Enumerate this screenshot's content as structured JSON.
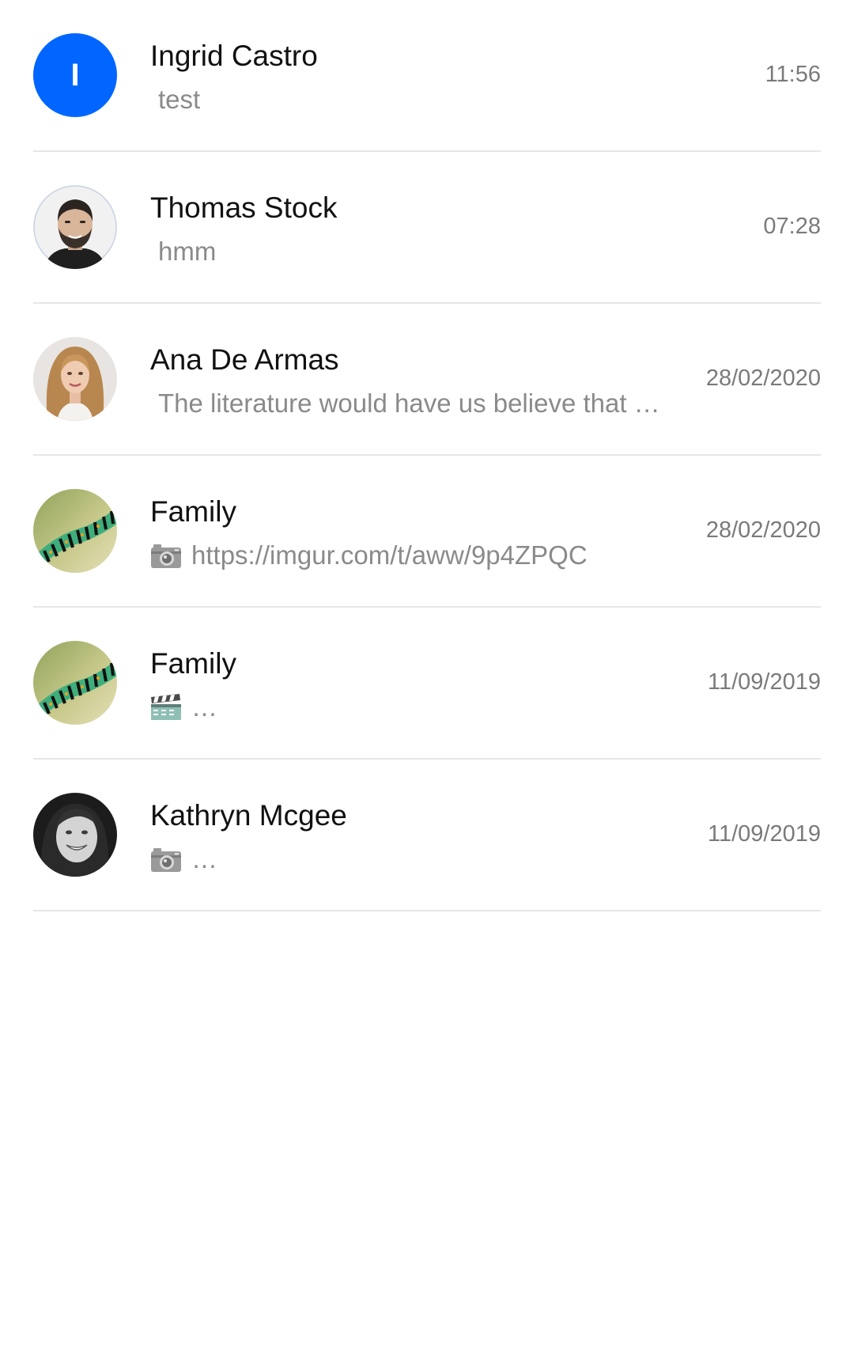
{
  "chats": [
    {
      "name": "Ingrid Castro",
      "preview": "test",
      "time": "11:56",
      "avatar": {
        "type": "initial",
        "initial": "I",
        "color": "#0066ff"
      }
    },
    {
      "name": "Thomas Stock",
      "preview": "hmm",
      "time": "07:28",
      "avatar": {
        "type": "photo",
        "subject": "man-with-beard"
      }
    },
    {
      "name": "Ana De Armas",
      "preview": "The literature would have us believe that …",
      "time": "28/02/2020",
      "avatar": {
        "type": "photo",
        "subject": "woman-blonde-hair"
      }
    },
    {
      "name": "Family",
      "preview": "https://imgur.com/t/aww/9p4ZPQC",
      "preview_icon": "camera-icon",
      "time": "28/02/2020",
      "avatar": {
        "type": "photo",
        "subject": "caterpillar"
      }
    },
    {
      "name": "Family",
      "preview": "…",
      "preview_icon": "clapperboard-icon",
      "time": "11/09/2019",
      "avatar": {
        "type": "photo",
        "subject": "caterpillar"
      }
    },
    {
      "name": "Kathryn Mcgee",
      "preview": "…",
      "preview_icon": "camera-icon",
      "time": "11/09/2019",
      "avatar": {
        "type": "photo",
        "subject": "woman-smiling-bw"
      }
    }
  ],
  "colors": {
    "accent": "#0066ff",
    "divider": "#e6e6e6",
    "name_text": "#111111",
    "preview_text": "#8a8a8a",
    "time_text": "#7a7a7a"
  }
}
